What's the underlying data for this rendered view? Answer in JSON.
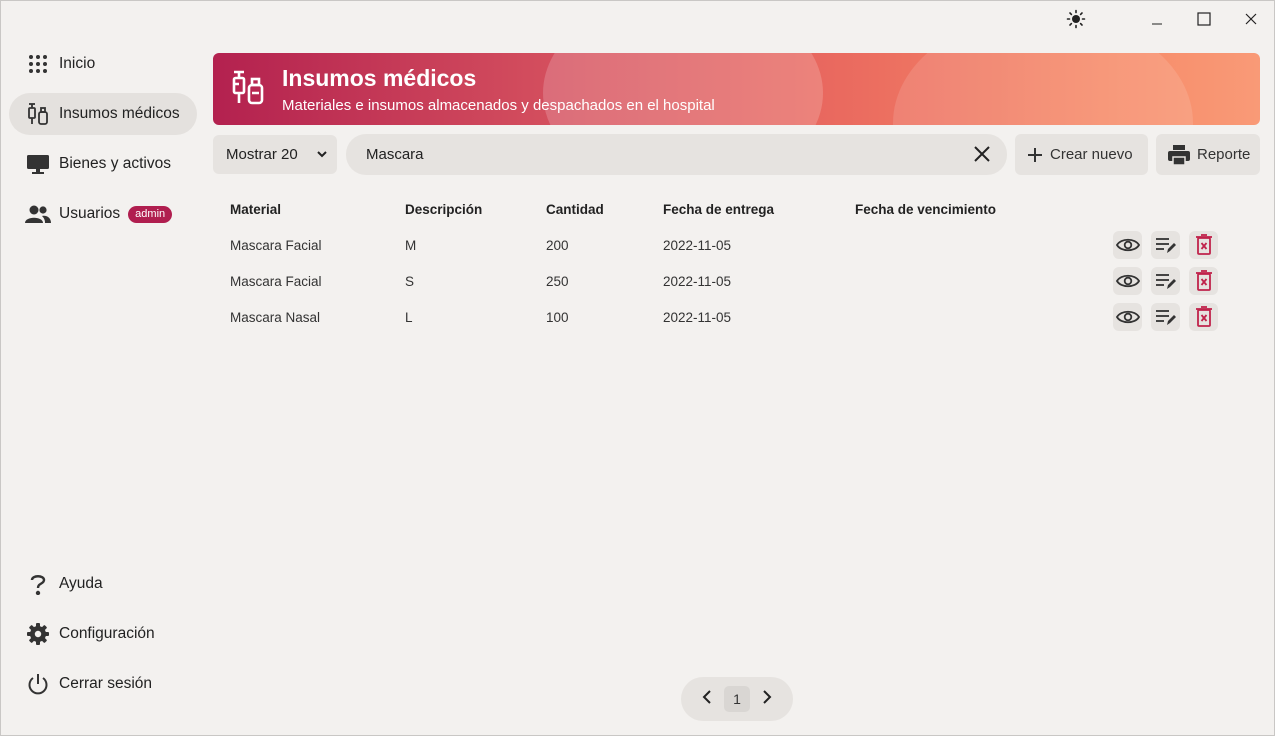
{
  "window": {
    "theme_icon": "sun-icon",
    "minimize_icon": "minimize-icon",
    "maximize_icon": "maximize-icon",
    "close_icon": "close-icon"
  },
  "sidebar": {
    "items": [
      {
        "label": "Inicio",
        "icon": "grid-dots-icon"
      },
      {
        "label": "Insumos médicos",
        "icon": "syringe-vial-icon",
        "active": true
      },
      {
        "label": "Bienes y activos",
        "icon": "monitor-icon"
      },
      {
        "label": "Usuarios",
        "icon": "users-icon",
        "badge": "admin"
      }
    ],
    "bottom_items": [
      {
        "label": "Ayuda",
        "icon": "question-icon"
      },
      {
        "label": "Configuración",
        "icon": "gear-icon"
      },
      {
        "label": "Cerrar sesión",
        "icon": "power-icon"
      }
    ]
  },
  "header": {
    "title": "Insumos médicos",
    "subtitle": "Materiales e insumos almacenados y despachados en el hospital"
  },
  "toolbar": {
    "page_size": "Mostrar 20",
    "search_value": "Mascara",
    "create_label": "Crear nuevo",
    "report_label": "Reporte"
  },
  "table": {
    "columns": [
      "Material",
      "Descripción",
      "Cantidad",
      "Fecha de entrega",
      "Fecha de vencimiento"
    ],
    "rows": [
      {
        "material": "Mascara Facial",
        "descripcion": "M",
        "cantidad": "200",
        "fecha_entrega": "2022-11-05",
        "fecha_vencimiento": ""
      },
      {
        "material": "Mascara Facial",
        "descripcion": "S",
        "cantidad": "250",
        "fecha_entrega": "2022-11-05",
        "fecha_vencimiento": ""
      },
      {
        "material": "Mascara Nasal",
        "descripcion": "L",
        "cantidad": "100",
        "fecha_entrega": "2022-11-05",
        "fecha_vencimiento": ""
      }
    ]
  },
  "pager": {
    "current": "1"
  },
  "colors": {
    "accent": "#b01e4f",
    "delete": "#c0234b",
    "banner_start": "#b3214f",
    "banner_end": "#f99a77"
  }
}
